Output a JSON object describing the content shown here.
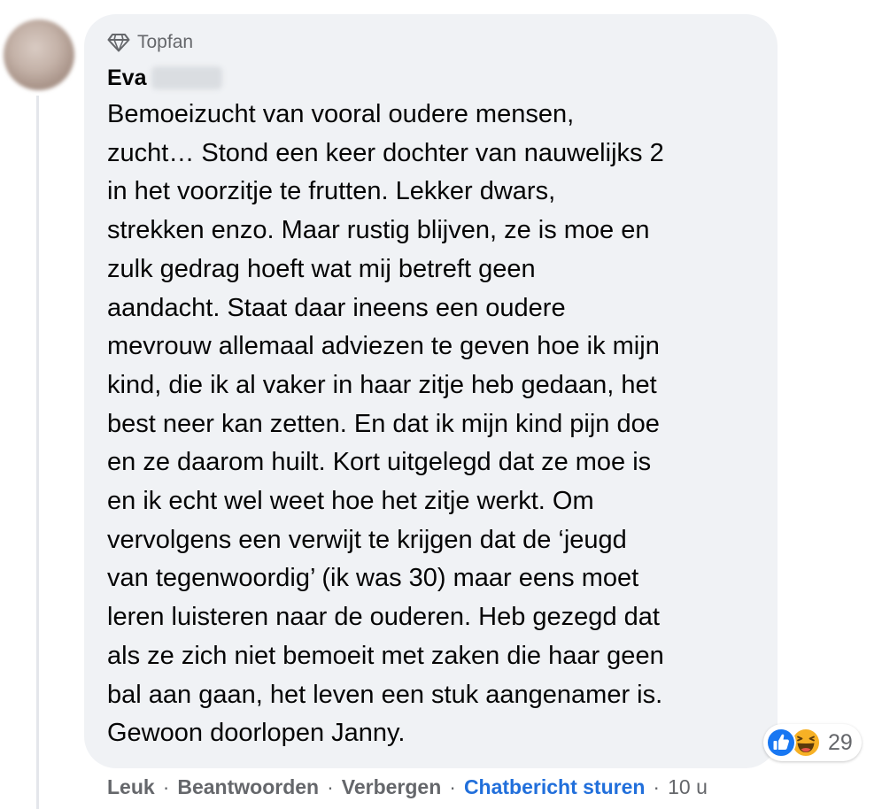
{
  "comment": {
    "badge_label": "Topfan",
    "badge_icon": "diamond-icon",
    "author_first_name": "Eva",
    "text": "Bemoeizucht van vooral oudere mensen,\nzucht… Stond een keer dochter van nauwelijks 2\nin het voorzitje te frutten. Lekker dwars,\nstrekken enzo. Maar rustig blijven, ze is moe en\nzulk gedrag hoeft wat mij betreft geen\naandacht. Staat daar ineens een oudere\nmevrouw allemaal adviezen te geven hoe ik mijn\nkind, die ik al vaker in haar zitje heb gedaan, het\nbest neer kan zetten. En dat ik mijn kind pijn doe\nen ze daarom huilt. Kort uitgelegd dat ze moe is\nen ik echt wel weet hoe het zitje werkt. Om\nvervolgens een verwijt te krijgen dat de ‘jeugd\nvan tegenwoordig’ (ik was 30) maar eens moet\nleren luisteren naar de ouderen. Heb gezegd dat\nals ze zich niet bemoeit met zaken die haar geen\nbal aan gaan, het leven een stuk aangenamer is.\nGewoon doorlopen Janny."
  },
  "reactions": {
    "icons": [
      "like-icon",
      "haha-icon"
    ],
    "count": "29",
    "colors": {
      "like": "#1877f2",
      "haha": "#f7b125"
    }
  },
  "actions": {
    "like_label": "Leuk",
    "reply_label": "Beantwoorden",
    "hide_label": "Verbergen",
    "message_label": "Chatbericht sturen",
    "separator": "·",
    "timestamp": "10 u"
  },
  "colors": {
    "bubble_bg": "#f0f2f5",
    "secondary_text": "#65676b",
    "link_blue": "#216fdb",
    "primary_text": "#050505"
  }
}
